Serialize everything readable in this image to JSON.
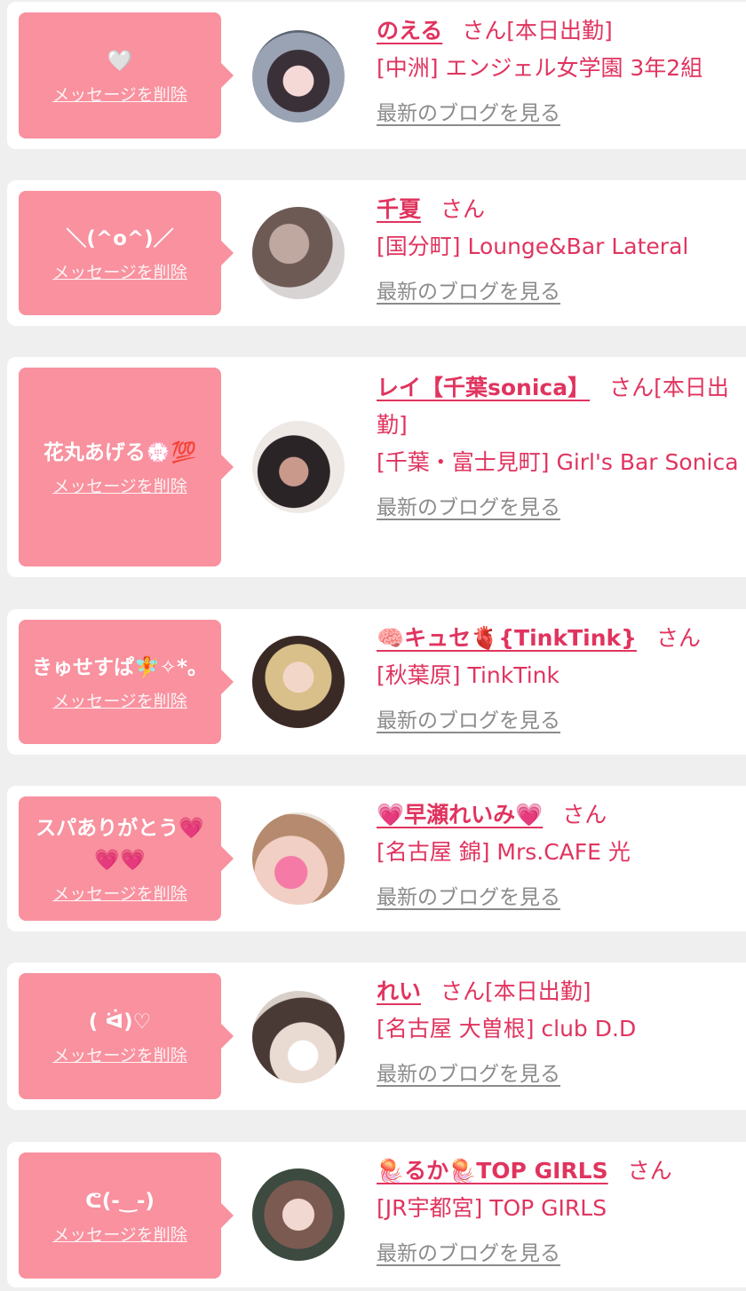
{
  "delete_label": "メッセージを削除",
  "blog_label": "最新のブログを見る",
  "san_label": "さん",
  "colors": {
    "bubble": "#f9919f",
    "name": "#e0345f",
    "link": "#8b8b8b"
  },
  "items": [
    {
      "message": "🤍",
      "name": "のえる",
      "status": "さん[本日出勤]",
      "shop": "[中洲] エンジェル女学園 3年2組"
    },
    {
      "message": "＼(^o^)／",
      "name": "千夏",
      "status": "さん",
      "shop": "[国分町] Lounge&Bar Lateral"
    },
    {
      "message": "花丸あげる💮💯",
      "name": "レイ【千葉sonica】",
      "status": "さん[本日出勤]",
      "shop": "[千葉・富士見町] Girl's Bar Sonica"
    },
    {
      "message": "きゅせすぱ🧚✧*。",
      "name": "🧠キュセ🫀{TinkTink}",
      "status": "さん",
      "shop": "[秋葉原] TinkTink"
    },
    {
      "message": "スパありがとう💗💗💗",
      "name": "💗早瀬れいみ💗",
      "status": "さん",
      "shop": "[名古屋 錦] Mrs.CAFE 光"
    },
    {
      "message": "( ᐛ)♡",
      "name": "れい",
      "status": "さん[本日出勤]",
      "shop": "[名古屋 大曽根] club D.D"
    },
    {
      "message": "ᕦ(-‿-)",
      "name": "🪼るか🪼TOP GIRLS",
      "status": "さん",
      "shop": "[JR宇都宮] TOP GIRLS"
    }
  ]
}
